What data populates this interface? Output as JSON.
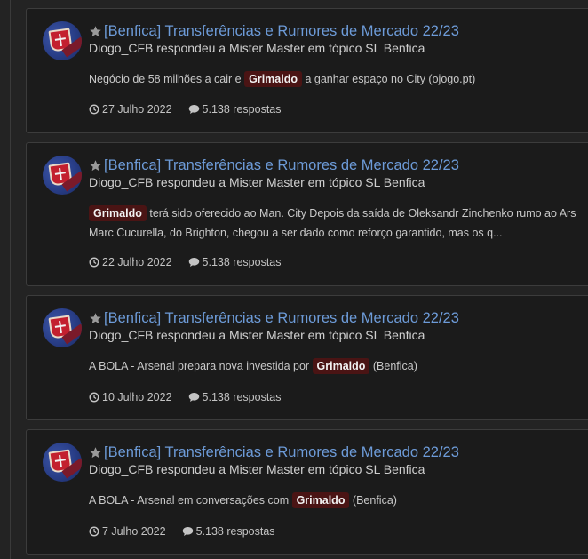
{
  "posts": [
    {
      "title": "[Benfica] Transferências e Rumores de Mercado 22/23",
      "subline": "Diogo_CFB respondeu a Mister Master em tópico SL Benfica",
      "snippet": {
        "line1_before": "Negócio de 58 milhões a cair e ",
        "highlight": "Grimaldo",
        "line1_after": " a ganhar espaço no City (ojogo.pt)",
        "line2": ""
      },
      "date": "27 Julho 2022",
      "replies": "5.138 respostas"
    },
    {
      "title": "[Benfica] Transferências e Rumores de Mercado 22/23",
      "subline": "Diogo_CFB respondeu a Mister Master em tópico SL Benfica",
      "snippet": {
        "line1_before": "",
        "highlight": "Grimaldo",
        "line1_after": " terá sido oferecido ao Man. City Depois da saída de Oleksandr Zinchenko rumo ao Ars",
        "line2": "Marc Cucurella, do Brighton, chegou a ser dado como reforço garantido, mas os q..."
      },
      "date": "22 Julho 2022",
      "replies": "5.138 respostas"
    },
    {
      "title": "[Benfica] Transferências e Rumores de Mercado 22/23",
      "subline": "Diogo_CFB respondeu a Mister Master em tópico SL Benfica",
      "snippet": {
        "line1_before": "A BOLA - Arsenal prepara nova investida por ",
        "highlight": "Grimaldo",
        "line1_after": " (Benfica)",
        "line2": ""
      },
      "date": "10 Julho 2022",
      "replies": "5.138 respostas"
    },
    {
      "title": "[Benfica] Transferências e Rumores de Mercado 22/23",
      "subline": "Diogo_CFB respondeu a Mister Master em tópico SL Benfica",
      "snippet": {
        "line1_before": "A BOLA - Arsenal em conversações com ",
        "highlight": "Grimaldo",
        "line1_after": " (Benfica)",
        "line2": ""
      },
      "date": "7 Julho 2022",
      "replies": "5.138 respostas"
    }
  ],
  "icons": {
    "star": "star-icon",
    "clock": "clock-icon",
    "comment": "comment-icon"
  },
  "colors": {
    "title_link": "#6d9bd8",
    "highlight_bg": "#4a1414"
  }
}
